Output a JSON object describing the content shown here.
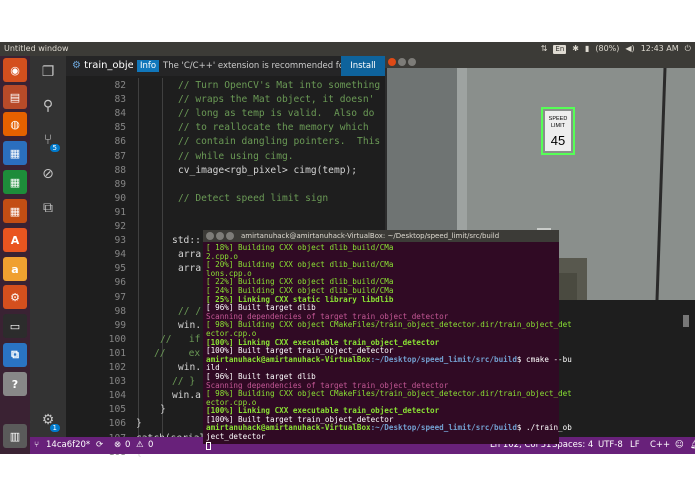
{
  "topbar": {
    "window_title": "Untitled window",
    "keyboard": "En",
    "battery": "(80%)",
    "time": "12:43 AM"
  },
  "launcher": {
    "items": [
      {
        "name": "ubuntu-icon",
        "color": "#d44f1e"
      },
      {
        "name": "files-icon",
        "color": "#b84a29"
      },
      {
        "name": "firefox-icon",
        "color": "#e66000"
      },
      {
        "name": "writer-icon",
        "color": "#2b6ebf"
      },
      {
        "name": "calc-icon",
        "color": "#1e8c3a"
      },
      {
        "name": "impress-icon",
        "color": "#c34d14"
      },
      {
        "name": "software-icon",
        "color": "#e95420"
      },
      {
        "name": "amazon-icon",
        "color": "#f0a030"
      },
      {
        "name": "settings-icon",
        "color": "#d44f1e"
      },
      {
        "name": "terminal-icon",
        "color": "#2c2c2c"
      },
      {
        "name": "vscode-icon",
        "color": "#2a73c4"
      },
      {
        "name": "help-icon",
        "color": "#888888"
      },
      {
        "name": "trash-icon",
        "color": "#5a5a5a"
      }
    ]
  },
  "editor": {
    "tab_label": "train_object",
    "source_control_badge": "5",
    "settings_badge": "1",
    "lines": [
      {
        "n": "82",
        "text": "// Turn OpenCV's Mat into something",
        "comment": true,
        "indent": 112
      },
      {
        "n": "83",
        "text": "// wraps the Mat object, it doesn'",
        "comment": true,
        "indent": 112
      },
      {
        "n": "84",
        "text": "// long as temp is valid.  Also do",
        "comment": true,
        "indent": 112
      },
      {
        "n": "85",
        "text": "// to reallocate the memory which",
        "comment": true,
        "indent": 112
      },
      {
        "n": "86",
        "text": "// contain dangling pointers.  This",
        "comment": true,
        "indent": 112
      },
      {
        "n": "87",
        "text": "// while using cimg.",
        "comment": true,
        "indent": 112
      },
      {
        "n": "88",
        "text": "cv_image<rgb_pixel> cimg(temp);",
        "comment": false,
        "indent": 112
      },
      {
        "n": "89",
        "text": "",
        "comment": false,
        "indent": 112
      },
      {
        "n": "90",
        "text": "// Detect speed limit sign",
        "comment": true,
        "indent": 112
      },
      {
        "n": "91",
        "text": "",
        "comment": false,
        "indent": 112
      },
      {
        "n": "92",
        "text": "",
        "comment": false,
        "indent": 112
      },
      {
        "n": "93",
        "text": "std::",
        "comment": false,
        "indent": 106
      },
      {
        "n": "94",
        "text": "arra",
        "comment": false,
        "indent": 112
      },
      {
        "n": "95",
        "text": "arra",
        "comment": false,
        "indent": 112
      },
      {
        "n": "96",
        "text": "",
        "comment": false,
        "indent": 112
      },
      {
        "n": "97",
        "text": "",
        "comment": false,
        "indent": 112
      },
      {
        "n": "98",
        "text": "// /",
        "comment": true,
        "indent": 112
      },
      {
        "n": "99",
        "text": "win.",
        "comment": false,
        "indent": 112
      },
      {
        "n": "100",
        "text": "//   if",
        "comment": true,
        "indent": 94
      },
      {
        "n": "101",
        "text": "//    ex",
        "comment": true,
        "indent": 88
      },
      {
        "n": "102",
        "text": "win.",
        "comment": false,
        "indent": 112
      },
      {
        "n": "103",
        "text": "// }",
        "comment": true,
        "indent": 106
      },
      {
        "n": "104",
        "text": "win.a",
        "comment": false,
        "indent": 106
      },
      {
        "n": "105",
        "text": "}",
        "comment": false,
        "indent": 94
      },
      {
        "n": "106",
        "text": "}",
        "comment": false,
        "indent": 70
      },
      {
        "n": "107",
        "text": "catch(serial",
        "comment": false,
        "indent": 70
      },
      {
        "n": "108",
        "text": "{",
        "comment": false,
        "indent": 70
      }
    ]
  },
  "notification": {
    "badge": "Info",
    "message": "The 'C/C++' extension is recommended for thi...",
    "install_label": "Install"
  },
  "status": {
    "branch": "14ca6f20*",
    "errors": "0",
    "warnings": "0",
    "position": "Ln 102, Col 31",
    "spaces": "Spaces: 4",
    "encoding": "UTF-8",
    "eol": "LF",
    "language": "C++"
  },
  "image_window": {
    "sign_line1": "SPEED",
    "sign_line2": "LIMIT",
    "sign_value": "45",
    "colors": {
      "wall": "#8a8f8c",
      "frame": "#56ff56"
    }
  },
  "terminal": {
    "title": "amirtanuhack@amirtanuhack-VirtualBox: ~/Desktop/speed_limit/src/build",
    "lines": [
      {
        "text": "[ 18%] Building CXX object dlib_build/CMa",
        "cls": "green"
      },
      {
        "text": "2.cpp.o",
        "cls": "green"
      },
      {
        "text": "[ 20%] Building CXX object dlib_build/CMa",
        "cls": "green"
      },
      {
        "text": "lons.cpp.o",
        "cls": "green"
      },
      {
        "text": "[ 22%] Building CXX object dlib_build/CMa",
        "cls": "green"
      },
      {
        "text": "[ 24%] Building CXX object dlib_build/CMa",
        "cls": "green"
      },
      {
        "text": "[ 25%] Linking CXX static library libdlib",
        "cls": "green bold"
      },
      {
        "text": "[ 96%] Built target dlib",
        "cls": ""
      },
      {
        "text": "Scanning dependencies of target train_object_detector",
        "cls": "pink"
      },
      {
        "text": "[ 98%] Building CXX object CMakeFiles/train_object_detector.dir/train_object_det",
        "cls": "green"
      },
      {
        "text": "ector.cpp.o",
        "cls": "green"
      },
      {
        "text": "[100%] Linking CXX executable train_object_detector",
        "cls": "green bold"
      },
      {
        "text": "[100%] Built target train_object_detector",
        "cls": ""
      },
      {
        "prompt": "amirtanuhack@amirtanuhack-VirtualBox",
        "path": ":~/Desktop/speed_limit/src/build",
        "cmd": "$ cmake --bu"
      },
      {
        "text": "ild .",
        "cls": ""
      },
      {
        "text": "[ 96%] Built target dlib",
        "cls": ""
      },
      {
        "text": "Scanning dependencies of target train_object_detector",
        "cls": "pink"
      },
      {
        "text": "[ 98%] Building CXX object CMakeFiles/train_object_detector.dir/train_object_det",
        "cls": "green"
      },
      {
        "text": "ector.cpp.o",
        "cls": "green"
      },
      {
        "text": "[100%] Linking CXX executable train_object_detector",
        "cls": "green bold"
      },
      {
        "text": "[100%] Built target train_object_detector",
        "cls": ""
      },
      {
        "prompt": "amirtanuhack@amirtanuhack-VirtualBox",
        "path": ":~/Desktop/speed_limit/src/build",
        "cmd": "$ ./train_ob"
      },
      {
        "text": "ject_detector",
        "cls": ""
      }
    ]
  }
}
